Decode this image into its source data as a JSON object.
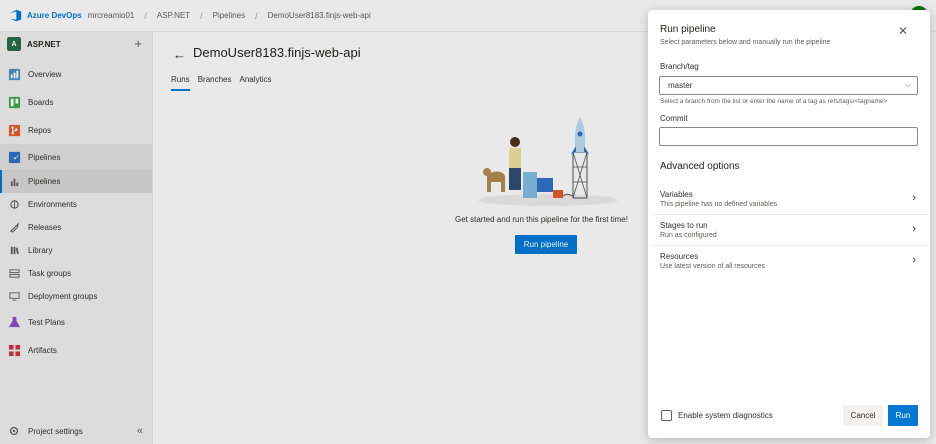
{
  "topbar": {
    "brand": "Azure DevOps",
    "breadcrumbs": [
      "mrcreamio01",
      "ASP.NET",
      "Pipelines",
      "DemoUser8183.finjs-web-api"
    ]
  },
  "sidebar": {
    "project_badge": "A",
    "project_name": "ASP.NET",
    "items": [
      {
        "label": "Overview",
        "icon": "overview-icon"
      },
      {
        "label": "Boards",
        "icon": "boards-icon"
      },
      {
        "label": "Repos",
        "icon": "repos-icon"
      },
      {
        "label": "Pipelines",
        "icon": "pipelines-icon"
      },
      {
        "label": "Pipelines",
        "icon": "pipelines-sub-icon"
      },
      {
        "label": "Environments",
        "icon": "environments-icon"
      },
      {
        "label": "Releases",
        "icon": "releases-icon"
      },
      {
        "label": "Library",
        "icon": "library-icon"
      },
      {
        "label": "Task groups",
        "icon": "task-groups-icon"
      },
      {
        "label": "Deployment groups",
        "icon": "deployment-groups-icon"
      },
      {
        "label": "Test Plans",
        "icon": "test-plans-icon"
      },
      {
        "label": "Artifacts",
        "icon": "artifacts-icon"
      }
    ],
    "footer_label": "Project settings"
  },
  "main": {
    "title": "DemoUser8183.finjs-web-api",
    "tabs": [
      "Runs",
      "Branches",
      "Analytics"
    ],
    "empty_message": "Get started and run this pipeline for the first time!",
    "run_button": "Run pipeline"
  },
  "panel": {
    "title": "Run pipeline",
    "subtitle": "Select parameters below and manually run the pipeline",
    "branch_label": "Branch/tag",
    "branch_value": "master",
    "branch_hint": "Select a branch from the list or enter the name of a tag as refs/tags/<tagname>",
    "commit_label": "Commit",
    "commit_value": "",
    "advanced_title": "Advanced options",
    "options": [
      {
        "title": "Variables",
        "subtitle": "This pipeline has no defined variables"
      },
      {
        "title": "Stages to run",
        "subtitle": "Run as configured"
      },
      {
        "title": "Resources",
        "subtitle": "Use latest version of all resources"
      }
    ],
    "diagnostics_label": "Enable system diagnostics",
    "diagnostics_checked": false,
    "cancel_label": "Cancel",
    "run_label": "Run"
  },
  "colors": {
    "accent": "#0078d4",
    "project_badge": "#2a6b4a"
  }
}
